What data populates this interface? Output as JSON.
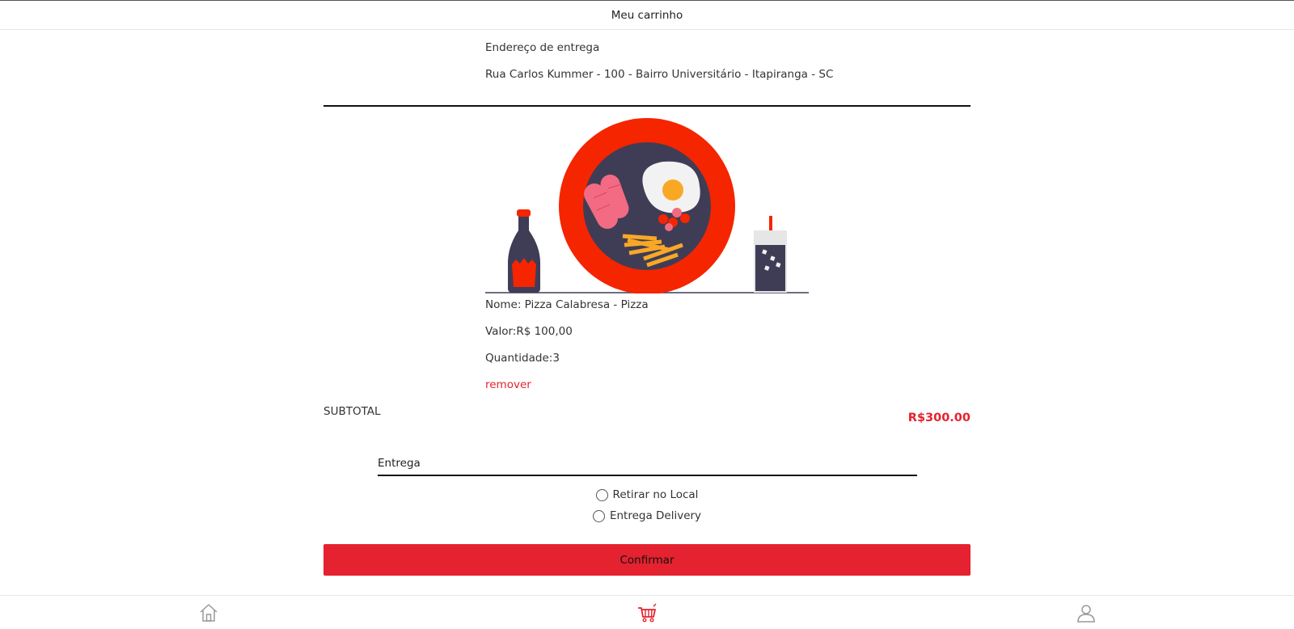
{
  "header": {
    "title": "Meu carrinho"
  },
  "address": {
    "label": "Endereço de entrega",
    "value": "Rua Carlos Kummer - 100 - Bairro Universitário - Itapiranga - SC"
  },
  "item": {
    "image": "food-plate-illustration",
    "name": "Nome: Pizza Calabresa - Pizza",
    "price": "Valor:R$ 100,00",
    "quantity": "Quantidade:3",
    "remove_label": "remover"
  },
  "summary": {
    "subtotal_label": "SUBTOTAL",
    "subtotal_value": "R$300.00"
  },
  "delivery": {
    "field_label": "Entrega",
    "options": [
      "Retirar no Local",
      "Entrega Delivery"
    ]
  },
  "confirm_label": "Confirmar",
  "bottom_nav": {
    "items": [
      {
        "icon": "home-icon",
        "active": false
      },
      {
        "icon": "cart-icon",
        "active": true
      },
      {
        "icon": "user-icon",
        "active": false
      }
    ]
  },
  "colors": {
    "accent": "#e5222f",
    "plate": "#f52500",
    "dark": "#3f3d56",
    "fries": "#f9a826"
  }
}
